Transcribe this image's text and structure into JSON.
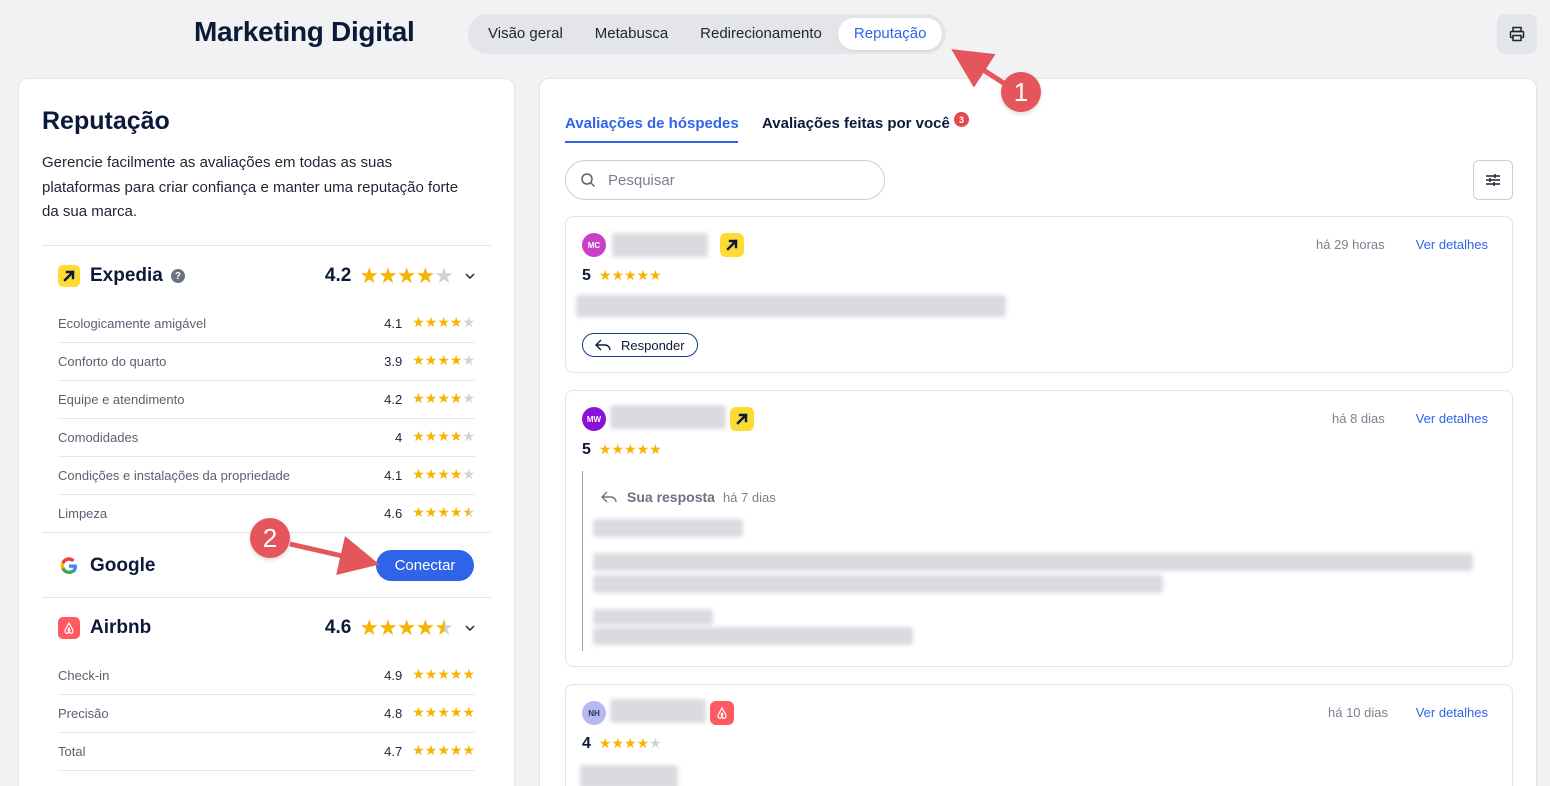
{
  "header": {
    "title": "Marketing Digital",
    "tabs": [
      {
        "label": "Visão geral",
        "active": false
      },
      {
        "label": "Metabusca",
        "active": false
      },
      {
        "label": "Redirecionamento",
        "active": false
      },
      {
        "label": "Reputação",
        "active": true
      }
    ],
    "print_icon": "printer-icon"
  },
  "left_panel": {
    "title": "Reputação",
    "description": "Gerencie facilmente as avaliações em todas as suas plataformas para criar confiança e manter uma reputação forte da sua marca.",
    "platforms": {
      "expedia": {
        "name": "Expedia",
        "score": "4.2",
        "categories": [
          {
            "label": "Ecologicamente amigável",
            "score": "4.1"
          },
          {
            "label": "Conforto do quarto",
            "score": "3.9"
          },
          {
            "label": "Equipe e atendimento",
            "score": "4.2"
          },
          {
            "label": "Comodidades",
            "score": "4"
          },
          {
            "label": "Condições e instalações da propriedade",
            "score": "4.1"
          },
          {
            "label": "Limpeza",
            "score": "4.6"
          }
        ]
      },
      "google": {
        "name": "Google",
        "connect_label": "Conectar"
      },
      "airbnb": {
        "name": "Airbnb",
        "score": "4.6",
        "categories": [
          {
            "label": "Check-in",
            "score": "4.9"
          },
          {
            "label": "Precisão",
            "score": "4.8"
          },
          {
            "label": "Total",
            "score": "4.7"
          }
        ]
      }
    }
  },
  "right_panel": {
    "tabs": [
      {
        "label": "Avaliações de hóspedes",
        "active": true
      },
      {
        "label": "Avaliações feitas por você",
        "badge": "3"
      }
    ],
    "search_placeholder": "Pesquisar",
    "reviews": [
      {
        "initials": "MC",
        "avatar_color": "#c93fc6",
        "source": "expedia",
        "time": "há 29 horas",
        "details_label": "Ver detalhes",
        "rating": "5",
        "reply_label": "Responder"
      },
      {
        "initials": "MW",
        "avatar_color": "#8a12d8",
        "source": "expedia",
        "time": "há 8 dias",
        "details_label": "Ver detalhes",
        "rating": "5",
        "response_label": "Sua resposta",
        "response_time": "há 7 dias"
      },
      {
        "initials": "NH",
        "avatar_color": "#b4b9f2",
        "source": "airbnb",
        "time": "há 10 dias",
        "details_label": "Ver detalhes",
        "rating": "4"
      }
    ]
  },
  "annotations": [
    {
      "number": "1"
    },
    {
      "number": "2"
    }
  ],
  "colors": {
    "accent": "#2f64e8",
    "star": "#f8b300",
    "annotation": "#e5565c",
    "expedia": "#fddb32",
    "airbnb": "#ff5a5f"
  }
}
